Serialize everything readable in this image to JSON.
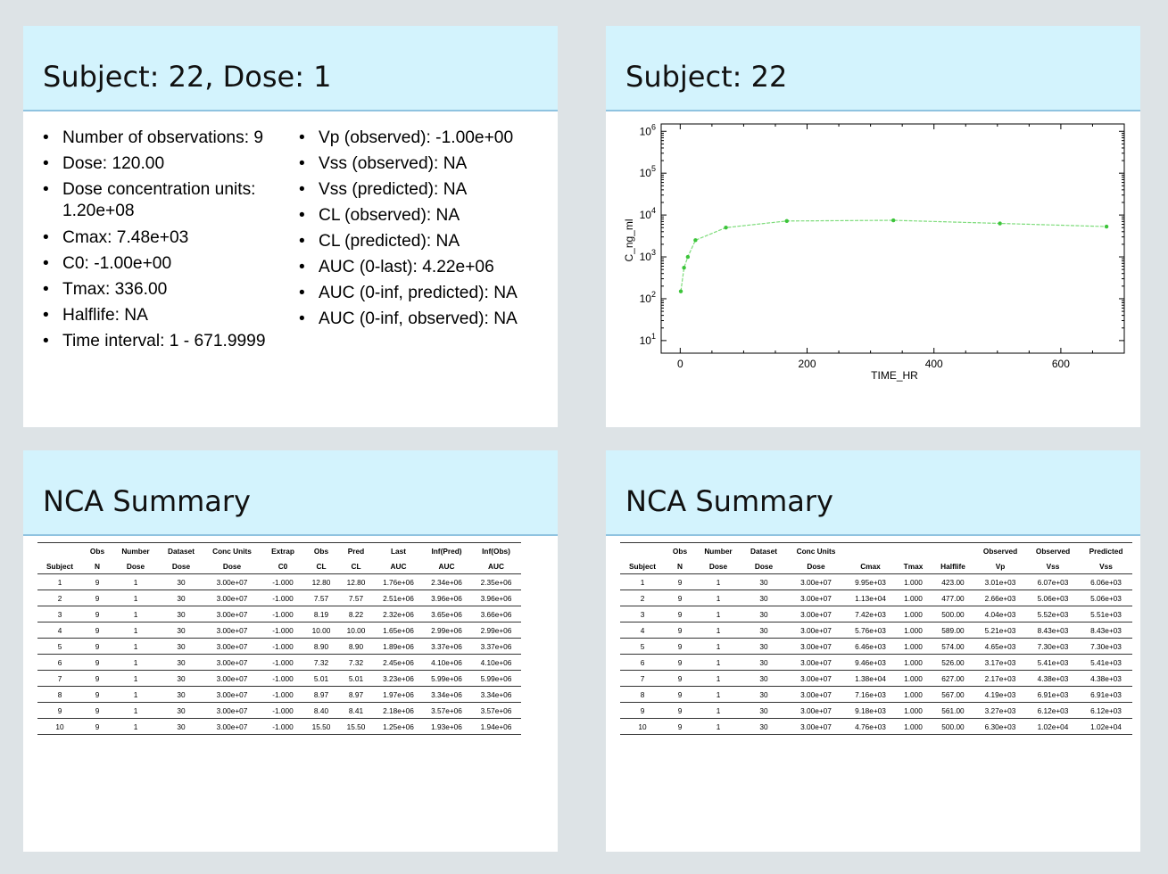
{
  "slide1": {
    "title": "Subject: 22,  Dose: 1",
    "col1": [
      "Number of observations: 9",
      "Dose:  120.00",
      "Dose concentration units: 1.20e+08",
      "Cmax:  7.48e+03",
      "C0:  -1.00e+00",
      "Tmax:  336.00",
      "Halflife:  NA",
      "Time interval:  1 - 671.9999"
    ],
    "col2": [
      "Vp  (observed): -1.00e+00",
      "Vss (observed): NA",
      "Vss (predicted): NA",
      "CL  (observed): NA",
      "CL  (predicted): NA",
      "AUC (0-last): 4.22e+06",
      "AUC (0-inf, predicted): NA",
      "AUC (0-inf, observed): NA"
    ]
  },
  "slide2": {
    "title": "Subject: 22"
  },
  "chart_data": {
    "type": "line",
    "title": "",
    "xlabel": "TIME_HR",
    "ylabel": "C_ng_ml",
    "x": [
      1,
      6,
      12,
      24,
      72,
      168,
      336,
      504,
      672
    ],
    "series": [
      {
        "values": [
          150,
          550,
          1000,
          2500,
          5000,
          7200,
          7480,
          6300,
          5300
        ]
      }
    ],
    "xlim": [
      -30,
      700
    ],
    "ylim": [
      5,
      1500000
    ],
    "yscale": "log",
    "xticks": [
      0,
      200,
      400,
      600
    ],
    "ytick_exponents": [
      1,
      2,
      3,
      4,
      5,
      6
    ],
    "line_color": "#7ddc7a",
    "marker_color": "#3cc43a",
    "grid": false
  },
  "nca1": {
    "title": "NCA Summary",
    "header_row1": [
      "",
      "Obs",
      "Number",
      "Dataset",
      "Conc Units",
      "Extrap",
      "Obs",
      "Pred",
      "Last",
      "Inf(Pred)",
      "Inf(Obs)"
    ],
    "header_row2": [
      "Subject",
      "N",
      "Dose",
      "Dose",
      "Dose",
      "C0",
      "CL",
      "CL",
      "AUC",
      "AUC",
      "AUC"
    ],
    "rows": [
      [
        "1",
        "9",
        "1",
        "30",
        "3.00e+07",
        "-1.000",
        "12.80",
        "12.80",
        "1.76e+06",
        "2.34e+06",
        "2.35e+06"
      ],
      [
        "2",
        "9",
        "1",
        "30",
        "3.00e+07",
        "-1.000",
        "7.57",
        "7.57",
        "2.51e+06",
        "3.96e+06",
        "3.96e+06"
      ],
      [
        "3",
        "9",
        "1",
        "30",
        "3.00e+07",
        "-1.000",
        "8.19",
        "8.22",
        "2.32e+06",
        "3.65e+06",
        "3.66e+06"
      ],
      [
        "4",
        "9",
        "1",
        "30",
        "3.00e+07",
        "-1.000",
        "10.00",
        "10.00",
        "1.65e+06",
        "2.99e+06",
        "2.99e+06"
      ],
      [
        "5",
        "9",
        "1",
        "30",
        "3.00e+07",
        "-1.000",
        "8.90",
        "8.90",
        "1.89e+06",
        "3.37e+06",
        "3.37e+06"
      ],
      [
        "6",
        "9",
        "1",
        "30",
        "3.00e+07",
        "-1.000",
        "7.32",
        "7.32",
        "2.45e+06",
        "4.10e+06",
        "4.10e+06"
      ],
      [
        "7",
        "9",
        "1",
        "30",
        "3.00e+07",
        "-1.000",
        "5.01",
        "5.01",
        "3.23e+06",
        "5.99e+06",
        "5.99e+06"
      ],
      [
        "8",
        "9",
        "1",
        "30",
        "3.00e+07",
        "-1.000",
        "8.97",
        "8.97",
        "1.97e+06",
        "3.34e+06",
        "3.34e+06"
      ],
      [
        "9",
        "9",
        "1",
        "30",
        "3.00e+07",
        "-1.000",
        "8.40",
        "8.41",
        "2.18e+06",
        "3.57e+06",
        "3.57e+06"
      ],
      [
        "10",
        "9",
        "1",
        "30",
        "3.00e+07",
        "-1.000",
        "15.50",
        "15.50",
        "1.25e+06",
        "1.93e+06",
        "1.94e+06"
      ]
    ]
  },
  "nca2": {
    "title": "NCA Summary",
    "header_row1": [
      "",
      "Obs",
      "Number",
      "Dataset",
      "Conc Units",
      "",
      "",
      "",
      "Observed",
      "Observed",
      "Predicted"
    ],
    "header_row2": [
      "Subject",
      "N",
      "Dose",
      "Dose",
      "Dose",
      "Cmax",
      "Tmax",
      "Halflife",
      "Vp",
      "Vss",
      "Vss"
    ],
    "rows": [
      [
        "1",
        "9",
        "1",
        "30",
        "3.00e+07",
        "9.95e+03",
        "1.000",
        "423.00",
        "3.01e+03",
        "6.07e+03",
        "6.06e+03"
      ],
      [
        "2",
        "9",
        "1",
        "30",
        "3.00e+07",
        "1.13e+04",
        "1.000",
        "477.00",
        "2.66e+03",
        "5.06e+03",
        "5.06e+03"
      ],
      [
        "3",
        "9",
        "1",
        "30",
        "3.00e+07",
        "7.42e+03",
        "1.000",
        "500.00",
        "4.04e+03",
        "5.52e+03",
        "5.51e+03"
      ],
      [
        "4",
        "9",
        "1",
        "30",
        "3.00e+07",
        "5.76e+03",
        "1.000",
        "589.00",
        "5.21e+03",
        "8.43e+03",
        "8.43e+03"
      ],
      [
        "5",
        "9",
        "1",
        "30",
        "3.00e+07",
        "6.46e+03",
        "1.000",
        "574.00",
        "4.65e+03",
        "7.30e+03",
        "7.30e+03"
      ],
      [
        "6",
        "9",
        "1",
        "30",
        "3.00e+07",
        "9.46e+03",
        "1.000",
        "526.00",
        "3.17e+03",
        "5.41e+03",
        "5.41e+03"
      ],
      [
        "7",
        "9",
        "1",
        "30",
        "3.00e+07",
        "1.38e+04",
        "1.000",
        "627.00",
        "2.17e+03",
        "4.38e+03",
        "4.38e+03"
      ],
      [
        "8",
        "9",
        "1",
        "30",
        "3.00e+07",
        "7.16e+03",
        "1.000",
        "567.00",
        "4.19e+03",
        "6.91e+03",
        "6.91e+03"
      ],
      [
        "9",
        "9",
        "1",
        "30",
        "3.00e+07",
        "9.18e+03",
        "1.000",
        "561.00",
        "3.27e+03",
        "6.12e+03",
        "6.12e+03"
      ],
      [
        "10",
        "9",
        "1",
        "30",
        "3.00e+07",
        "4.76e+03",
        "1.000",
        "500.00",
        "6.30e+03",
        "1.02e+04",
        "1.02e+04"
      ]
    ]
  }
}
